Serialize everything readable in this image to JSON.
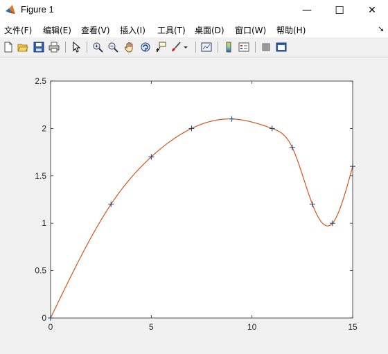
{
  "window": {
    "title": "Figure 1",
    "minimize_glyph": "—",
    "maximize_glyph": "☐",
    "close_glyph": "✕"
  },
  "menu": {
    "items": [
      "文件(F)",
      "编辑(E)",
      "查看(V)",
      "插入(I)",
      "工具(T)",
      "桌面(D)",
      "窗口(W)",
      "帮助(H)"
    ],
    "dock_arrow": "↘"
  },
  "toolbar": {
    "icons": [
      "new-figure-icon",
      "open-file-icon",
      "save-icon",
      "print-icon",
      "select-arrow-icon",
      "zoom-in-icon",
      "zoom-out-icon",
      "pan-hand-icon",
      "rotate-3d-icon",
      "data-cursor-icon",
      "brush-icon",
      "brush-dropdown-icon",
      "link-plot-icon",
      "colorbar-icon",
      "legend-icon",
      "hide-plot-tools-icon",
      "show-plot-tools-icon"
    ]
  },
  "colors": {
    "curve": "#d95319",
    "markers": "#0e3f7a",
    "axes": "#262626"
  },
  "chart_data": {
    "type": "line",
    "title": "",
    "xlabel": "",
    "ylabel": "",
    "xlim": [
      0,
      15
    ],
    "ylim": [
      0,
      2.5
    ],
    "xticks": [
      0,
      5,
      10,
      15
    ],
    "yticks": [
      0,
      0.5,
      1,
      1.5,
      2,
      2.5
    ],
    "xtick_labels": [
      "0",
      "5",
      "10",
      "15"
    ],
    "ytick_labels": [
      "0",
      "0.5",
      "1",
      "1.5",
      "2",
      "2.5"
    ],
    "grid": false,
    "series": [
      {
        "style": "markers-plus",
        "x": [
          0,
          3,
          5,
          7,
          9,
          11,
          12,
          13,
          14,
          15
        ],
        "y": [
          0,
          1.2,
          1.7,
          2.0,
          2.1,
          2.0,
          1.8,
          1.2,
          1.0,
          1.6
        ]
      },
      {
        "style": "spline-interpolation",
        "x": [
          0,
          3,
          5,
          7,
          9,
          11,
          12,
          13,
          14,
          15
        ],
        "y": [
          0,
          1.2,
          1.7,
          2.0,
          2.1,
          2.0,
          1.8,
          1.2,
          1.0,
          1.6
        ]
      }
    ]
  }
}
